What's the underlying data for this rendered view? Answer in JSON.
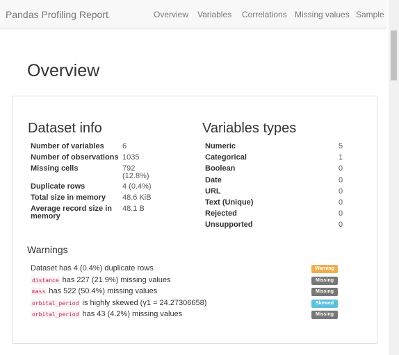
{
  "nav": {
    "brand": "Pandas Profiling Report",
    "links": [
      "Overview",
      "Variables",
      "Correlations",
      "Missing values",
      "Sample"
    ]
  },
  "page_title": "Overview",
  "dataset_info": {
    "title": "Dataset info",
    "rows": [
      {
        "label": "Number of variables",
        "value": "6"
      },
      {
        "label": "Number of observations",
        "value": "1035"
      },
      {
        "label": "Missing cells",
        "value": "792",
        "value2": "(12.8%)"
      },
      {
        "label": "Duplicate rows",
        "value": "4 (0.4%)"
      },
      {
        "label": "Total size in memory",
        "value": "48.6 KiB"
      },
      {
        "label": "Average record size in",
        "label2": "memory",
        "value": "48.1 B"
      }
    ]
  },
  "variable_types": {
    "title": "Variables types",
    "rows": [
      {
        "label": "Numeric",
        "value": "5"
      },
      {
        "label": "Categorical",
        "value": "1"
      },
      {
        "label": "Boolean",
        "value": "0"
      },
      {
        "label": "Date",
        "value": "0"
      },
      {
        "label": "URL",
        "value": "0"
      },
      {
        "label": "Text (Unique)",
        "value": "0"
      },
      {
        "label": "Rejected",
        "value": "0"
      },
      {
        "label": "Unsupported",
        "value": "0"
      }
    ]
  },
  "warnings": {
    "title": "Warnings",
    "items": [
      {
        "code": "",
        "text": "Dataset has 4 (0.4%) duplicate rows",
        "badge": "Warning",
        "color": "#f0ad4e"
      },
      {
        "code": "distance",
        "text": "has 227 (21.9%) missing values",
        "badge": "Missing",
        "color": "#777777"
      },
      {
        "code": "mass",
        "text": "has 522 (50.4%) missing values",
        "badge": "Missing",
        "color": "#777777"
      },
      {
        "code": "orbital_period",
        "text": "is highly skewed (γ1 = 24.27306658)",
        "badge": "Skewed",
        "color": "#5bc0de"
      },
      {
        "code": "orbital_period",
        "text": "has 43 (4.2%) missing values",
        "badge": "Missing",
        "color": "#777777"
      }
    ]
  }
}
